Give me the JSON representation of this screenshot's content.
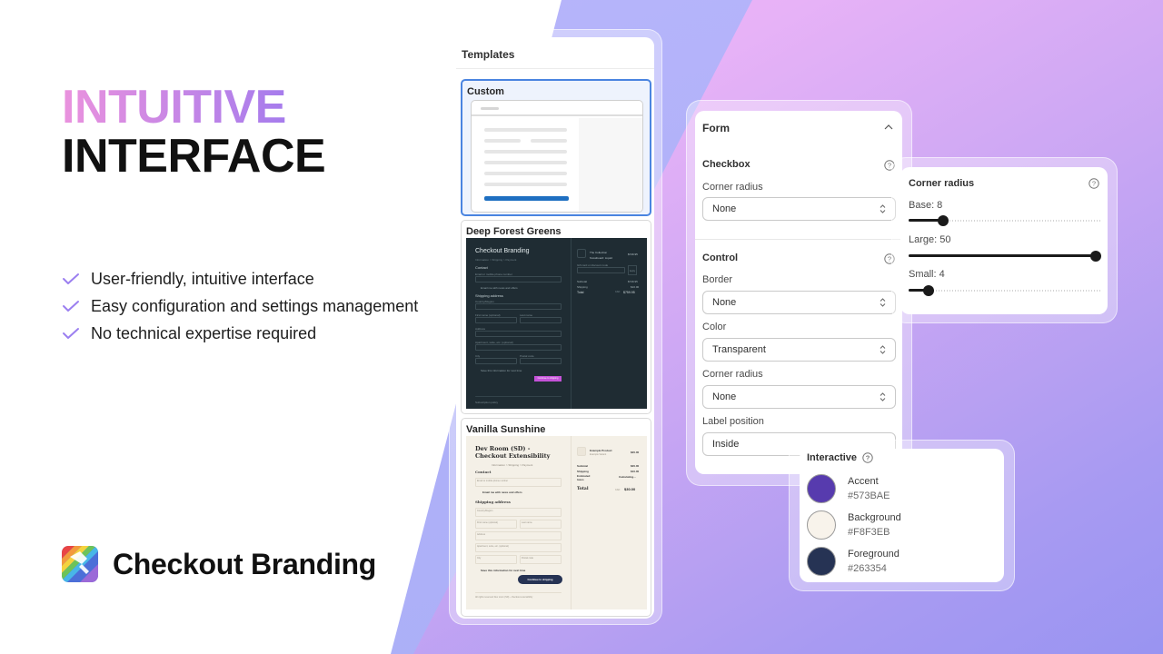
{
  "hero": {
    "title_line1": "INTUITIVE",
    "title_line2": "INTERFACE",
    "features": [
      "User-friendly, intuitive interface",
      "Easy configuration and settings management",
      "No technical expertise required"
    ],
    "brand_name": "Checkout Branding"
  },
  "templates": {
    "header": "Templates",
    "items": [
      {
        "name": "Custom",
        "selected": true
      },
      {
        "name": "Deep Forest Greens",
        "preview": {
          "store_title": "Checkout Branding",
          "breadcrumb": "Information > Shipping > Payment",
          "contact_label": "Contact",
          "email_label": "Email or mobile phone number",
          "newsletter": "Email me with news and offers",
          "shipping_label": "Shipping address",
          "country_label": "Country/Region",
          "first_name": "First name (optional)",
          "last_name": "Last name",
          "address": "Address",
          "apartment": "Apartment, suite, etc. (optional)",
          "city": "City",
          "postal": "Postal code",
          "save_info": "Save this information for next time",
          "continue_button": "Continue to shipping",
          "footer": "Subscription policy",
          "product": "The Collection Snowboard: Liquid",
          "product_price": "$749.95",
          "discount": "Gift card or discount code",
          "apply": "Apply",
          "subtotal_label": "Subtotal",
          "subtotal": "$749.95",
          "shipping_label_sum": "Shipping",
          "shipping": "$10.00",
          "total_label": "Total",
          "currency": "CAD",
          "total": "$759.95"
        }
      },
      {
        "name": "Vanilla Sunshine",
        "preview": {
          "store_title": "Dev Room (SD) - Checkout Extensibility",
          "breadcrumb": "Information > Shipping > Payment",
          "contact_label": "Contact",
          "email_label": "Email or mobile phone number",
          "newsletter": "Email me with news and offers",
          "shipping_label": "Shipping address",
          "country_label": "Country/Region",
          "first_name": "First name (optional)",
          "last_name": "Last name",
          "address": "Address",
          "apartment": "Apartment, suite, etc. (optional)",
          "city": "City",
          "postal": "Postal code",
          "save_info": "Save this information for next time",
          "continue_button": "Continue to shipping",
          "footer": "All rights reserved Dev room (SD) - checkout extensibility",
          "product": "Example Product",
          "product_variant": "Example Variant",
          "product_price": "$20.00",
          "subtotal_label": "Subtotal",
          "subtotal": "$20.00",
          "shipping_label_sum": "Shipping",
          "shipping": "$10.00",
          "taxes_label": "Estimated taxes",
          "taxes": "Calculating...",
          "total_label": "Total",
          "currency": "CAD",
          "total": "$30.00"
        }
      }
    ]
  },
  "form": {
    "title": "Form",
    "checkbox": {
      "title": "Checkbox",
      "corner_radius_label": "Corner radius",
      "corner_radius_value": "None"
    },
    "control": {
      "title": "Control",
      "border_label": "Border",
      "border_value": "None",
      "color_label": "Color",
      "color_value": "Transparent",
      "corner_radius_label": "Corner radius",
      "corner_radius_value": "None",
      "label_position_label": "Label position",
      "label_position_value": "Inside"
    }
  },
  "corner_radius": {
    "title": "Corner radius",
    "sliders": [
      {
        "label": "Base: 8",
        "value": 8,
        "fraction": 0.16
      },
      {
        "label": "Large: 50",
        "value": 50,
        "fraction": 1.0
      },
      {
        "label": "Small: 4",
        "value": 4,
        "fraction": 0.08
      }
    ]
  },
  "interactive": {
    "title": "Interactive",
    "colors": [
      {
        "name": "Accent",
        "hex": "#573BAE"
      },
      {
        "name": "Background",
        "hex": "#F8F3EB"
      },
      {
        "name": "Foreground",
        "hex": "#263354"
      }
    ]
  },
  "theme": {
    "check_color": "#9b7ff0",
    "selected_border": "#4a84e0",
    "dark_bg": "#1f2c33",
    "dark_button": "#c452d8",
    "vanilla_bg": "#f4f0e7",
    "vanilla_button": "#263354"
  }
}
